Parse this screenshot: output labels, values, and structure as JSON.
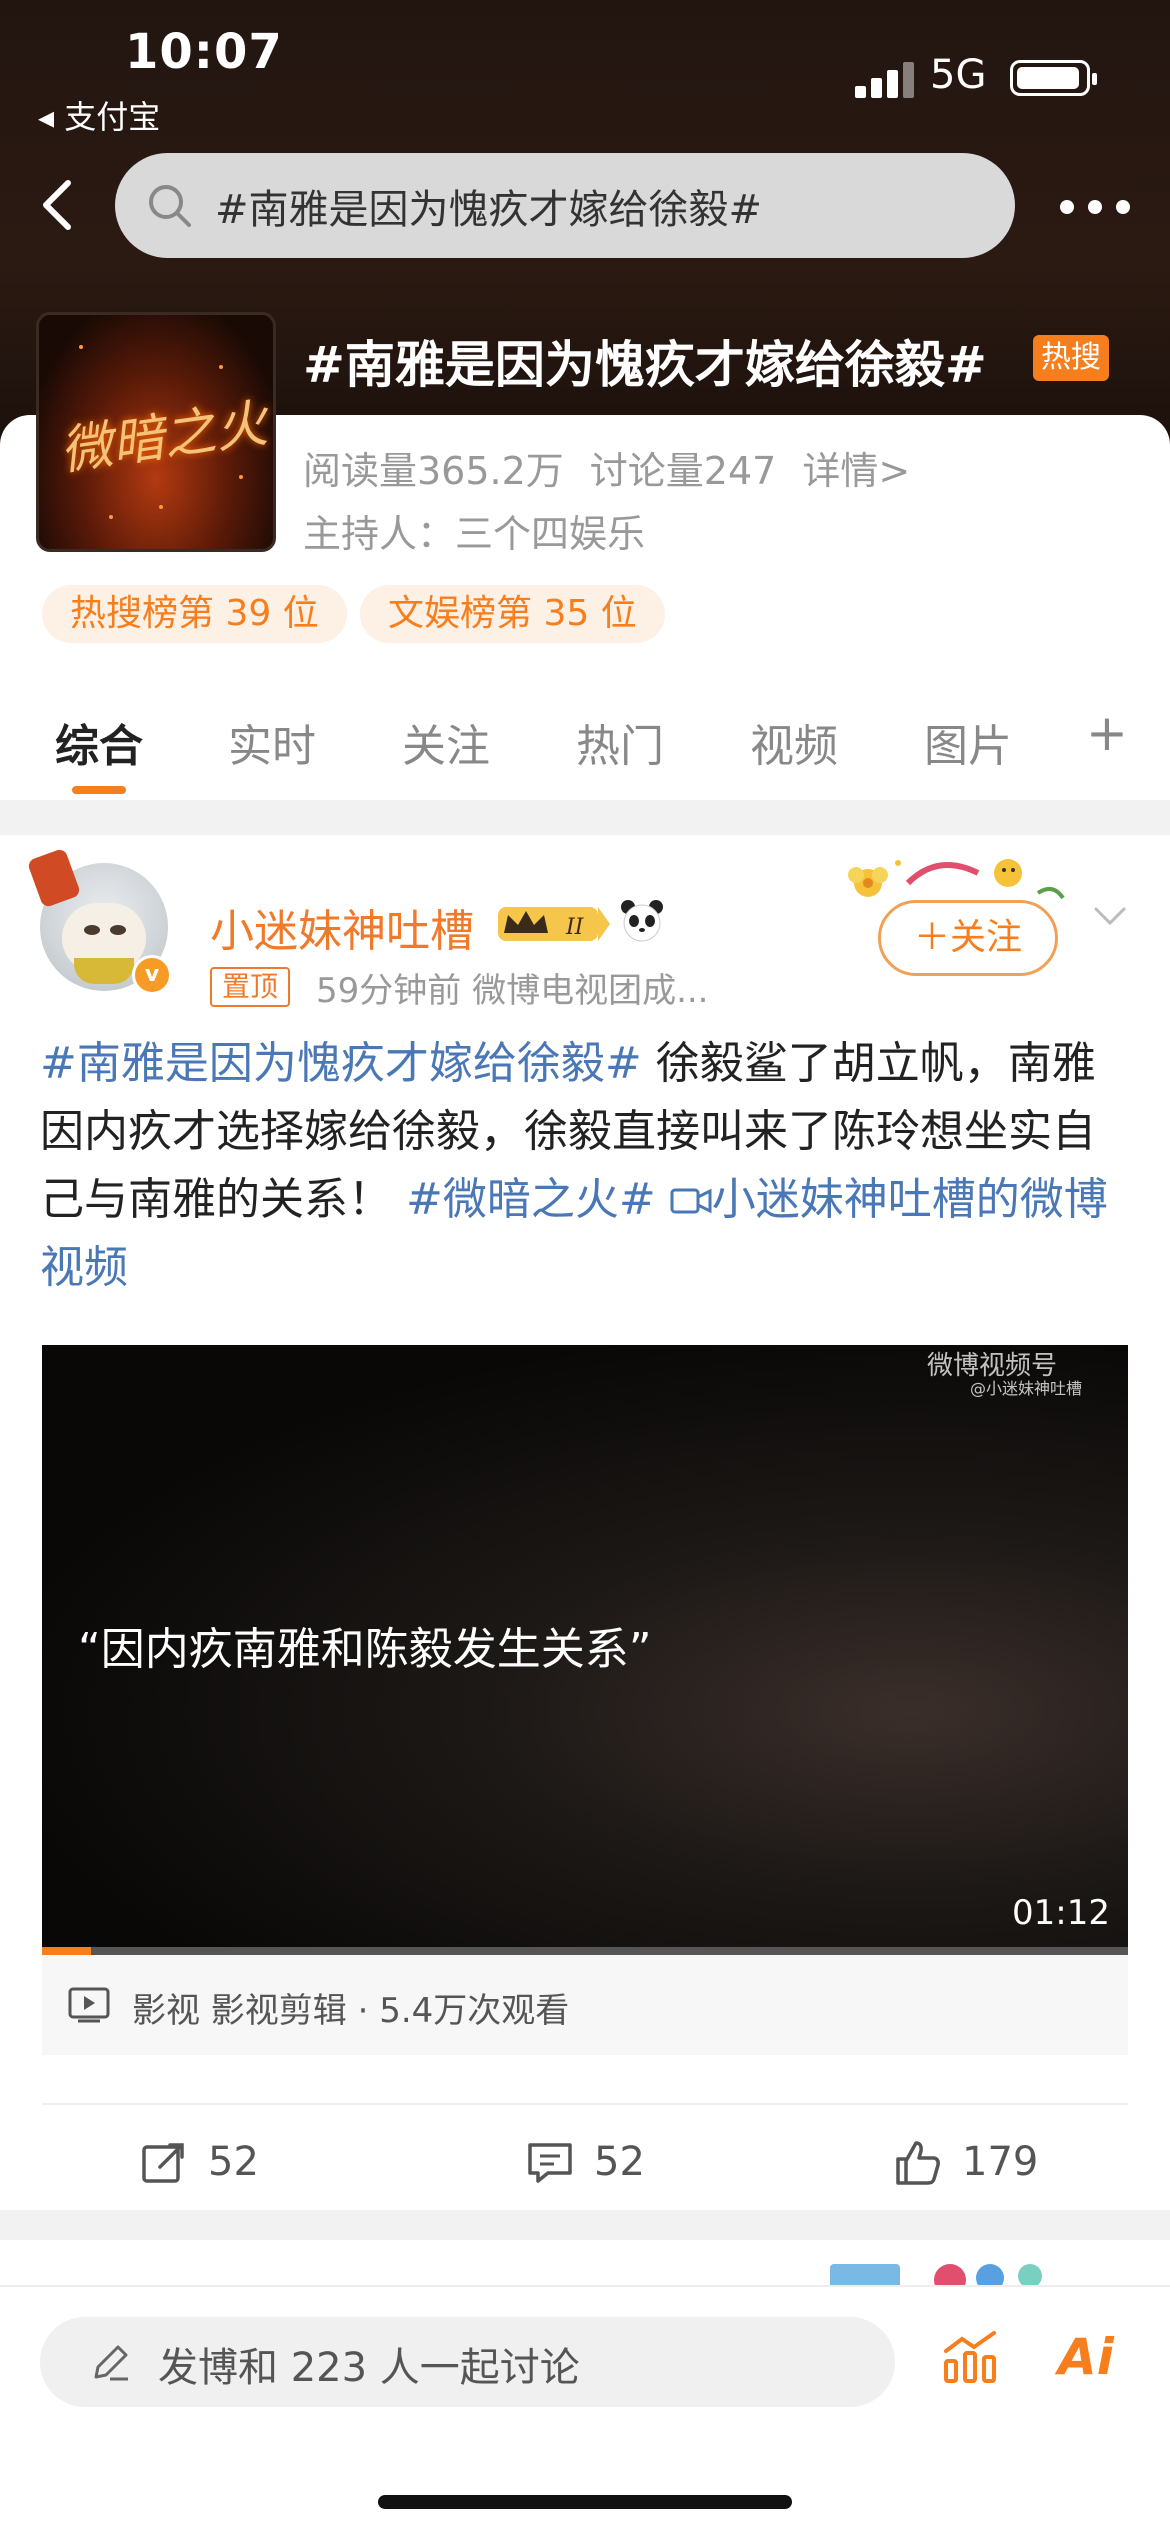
{
  "status_bar": {
    "time": "10:07",
    "back_app": "◂ 支付宝",
    "network": "5G"
  },
  "search": {
    "query": "#南雅是因为愧疚才嫁给徐毅#"
  },
  "topic": {
    "image_text": "微暗之火",
    "title": "#南雅是因为愧疚才嫁给徐毅#",
    "badge": "热搜",
    "read_count": "阅读量365.2万",
    "discuss_count": "讨论量247",
    "details_link": "详情>",
    "host": "主持人：三个四娱乐",
    "rankings": [
      "热搜榜第 39 位",
      "文娱榜第 35 位"
    ]
  },
  "tabs": [
    {
      "label": "综合",
      "active": true
    },
    {
      "label": "实时",
      "active": false
    },
    {
      "label": "关注",
      "active": false
    },
    {
      "label": "热门",
      "active": false
    },
    {
      "label": "视频",
      "active": false
    },
    {
      "label": "图片",
      "active": false
    },
    {
      "label": "+",
      "active": false
    }
  ],
  "post": {
    "username": "小迷妹神吐槽",
    "level_badge": "II",
    "pinned": "置顶",
    "meta": "59分钟前  微博电视团成...",
    "follow": "＋关注",
    "text_tag1": "#南雅是因为愧疚才嫁给徐毅#",
    "text_body": " 徐毅鲨了胡立帆，南雅因内疚才选择嫁给徐毅，徐毅直接叫来了陈玲想坐实自己与南雅的关系！",
    "text_tag2": "#微暗之火#",
    "text_link": "小迷妹神吐槽的微博视频",
    "video": {
      "watermark": "微博视频号",
      "watermark_handle": "@小迷妹神吐槽",
      "quote": "“因内疚南雅和陈毅发生关系”",
      "duration": "01:12",
      "progress": 0.045
    },
    "video_info": "影视  影视剪辑 · 5.4万次观看",
    "reposts": "52",
    "comments": "52",
    "likes": "179"
  },
  "bottom_bar": {
    "compose_placeholder": "发博和 223 人一起讨论",
    "ai_label": "Ai"
  },
  "colors": {
    "accent": "#f67e1d",
    "link": "#4a77b5"
  }
}
